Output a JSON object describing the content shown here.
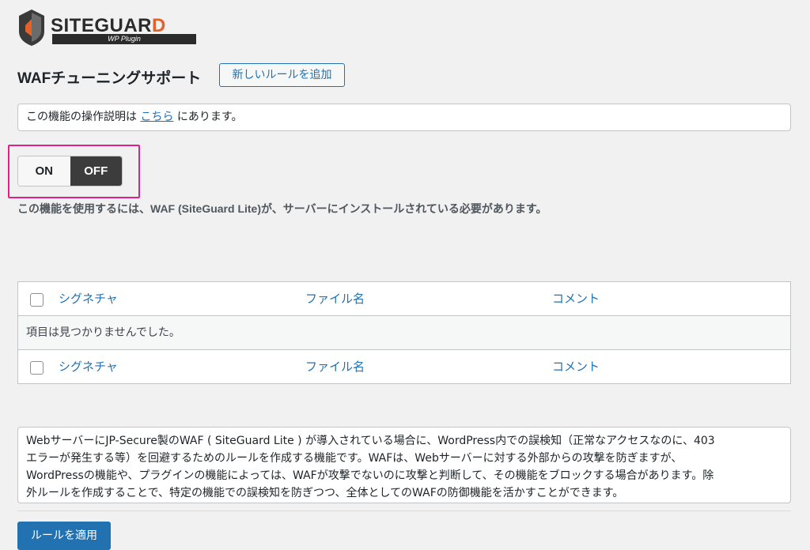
{
  "logo": {
    "word_main": "SITEGUAR",
    "word_last": "D",
    "sub": "WP Plugin"
  },
  "header": {
    "title": "WAFチューニングサポート",
    "add_rule_label": "新しいルールを追加"
  },
  "notice": {
    "prefix": "この機能の操作説明は ",
    "link": "こちら",
    "suffix": " にあります。"
  },
  "toggle": {
    "on_label": "ON",
    "off_label": "OFF",
    "state": "OFF"
  },
  "warning": "この機能を使用するには、WAF (SiteGuard Lite)が、サーバーにインストールされている必要があります。",
  "table": {
    "columns": [
      "シグネチャ",
      "ファイル名",
      "コメント"
    ],
    "empty_message": "項目は見つかりませんでした。"
  },
  "description": [
    "WebサーバーにJP-Secure製のWAF ( SiteGuard Lite ) が導入されている場合に、WordPress内での誤検知（正常なアクセスなのに、403",
    "エラーが発生する等）を回避するためのルールを作成する機能です。WAFは、Webサーバーに対する外部からの攻撃を防ぎますが、",
    "WordPressの機能や、プラグインの機能によっては、WAFが攻撃でないのに攻撃と判断して、その機能をブロックする場合があります。除",
    "外ルールを作成することで、特定の機能での誤検知を防ぎつつ、全体としてのWAFの防御機能を活かすことができます。"
  ],
  "apply_label": "ルールを適用",
  "colors": {
    "accent": "#2271b1",
    "highlight": "#e0218a",
    "toggle_dark": "#3c3c3c"
  }
}
